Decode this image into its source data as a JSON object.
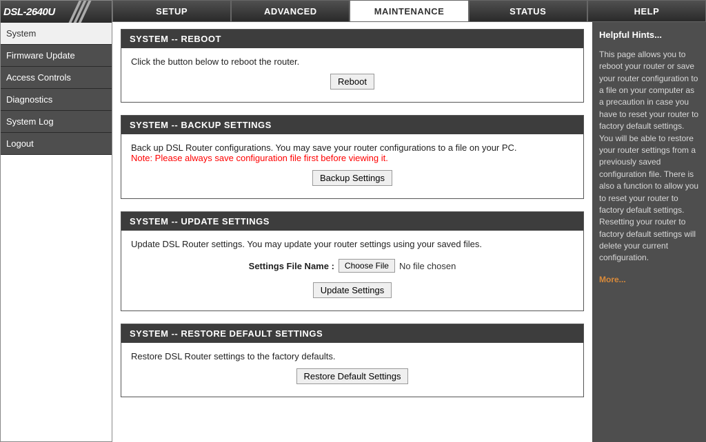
{
  "device_model": "DSL-2640U",
  "top_tabs": [
    {
      "label": "SETUP"
    },
    {
      "label": "ADVANCED"
    },
    {
      "label": "MAINTENANCE"
    },
    {
      "label": "STATUS"
    },
    {
      "label": "HELP"
    }
  ],
  "active_top_tab": "MAINTENANCE",
  "sidebar": {
    "items": [
      {
        "label": "System"
      },
      {
        "label": "Firmware Update"
      },
      {
        "label": "Access Controls"
      },
      {
        "label": "Diagnostics"
      },
      {
        "label": "System Log"
      },
      {
        "label": "Logout"
      }
    ],
    "active": "System"
  },
  "panels": {
    "reboot": {
      "title": "SYSTEM -- REBOOT",
      "text": "Click the button below to reboot the router.",
      "button": "Reboot"
    },
    "backup": {
      "title": "SYSTEM -- BACKUP SETTINGS",
      "text": "Back up DSL Router configurations. You may save your router configurations to a file on your PC.",
      "note": "Note: Please always save configuration file first before viewing it.",
      "button": "Backup Settings"
    },
    "update": {
      "title": "SYSTEM -- UPDATE SETTINGS",
      "text": "Update DSL Router settings. You may update your router settings using your saved files.",
      "file_label": "Settings File Name :",
      "choose_file": "Choose File",
      "no_file": "No file chosen",
      "button": "Update Settings"
    },
    "restore": {
      "title": "SYSTEM -- RESTORE DEFAULT SETTINGS",
      "text": "Restore DSL Router settings to the factory defaults.",
      "button": "Restore Default Settings"
    }
  },
  "help": {
    "heading": "Helpful Hints...",
    "body": "This page allows you to reboot your router or save your router configuration to a file on your computer as a precaution in case you have to reset your router to factory default settings. You will be able to restore your router settings from a previously saved configuration file. There is also a function to allow you to reset your router to factory default settings. Resetting your router to factory default settings will delete your current configuration.",
    "more": "More..."
  }
}
